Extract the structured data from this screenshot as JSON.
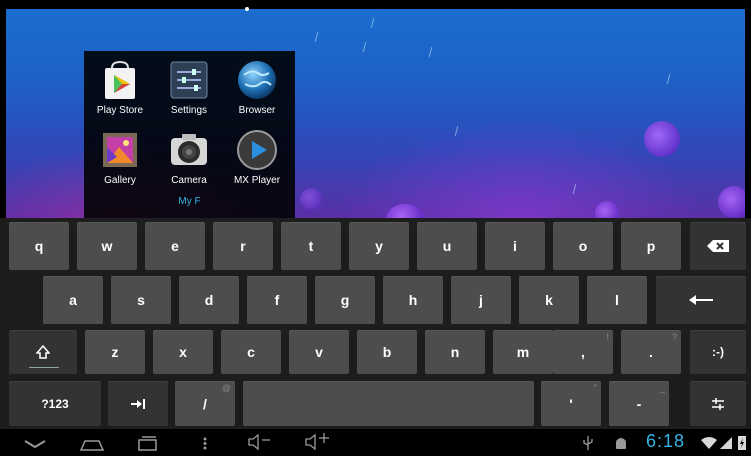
{
  "folder": {
    "name": "My F",
    "apps": [
      {
        "label": "Play Store",
        "icon": "play-store-icon"
      },
      {
        "label": "Settings",
        "icon": "settings-icon"
      },
      {
        "label": "Browser",
        "icon": "browser-icon"
      },
      {
        "label": "Gallery",
        "icon": "gallery-icon"
      },
      {
        "label": "Camera",
        "icon": "camera-icon"
      },
      {
        "label": "MX Player",
        "icon": "mx-player-icon"
      }
    ]
  },
  "keyboard": {
    "row1": [
      "q",
      "w",
      "e",
      "r",
      "t",
      "y",
      "u",
      "i",
      "o",
      "p"
    ],
    "row2": [
      "a",
      "s",
      "d",
      "f",
      "g",
      "h",
      "j",
      "k",
      "l"
    ],
    "row3": [
      "z",
      "x",
      "c",
      "v",
      "b",
      "n",
      "m"
    ],
    "comma": ",",
    "comma_hint": "!",
    "period": ".",
    "period_hint": "?",
    "smiley": ":-)",
    "symbols": "?123",
    "slash": "/",
    "slash_hint": "@",
    "apostrophe": "'",
    "apostrophe_hint": "\"",
    "dash": "-",
    "dash_hint": "_"
  },
  "status": {
    "time": "6:18"
  },
  "colors": {
    "accent": "#33b5e5",
    "key": "#4d4d4d",
    "keyboard_bg": "#1d1d1d"
  }
}
